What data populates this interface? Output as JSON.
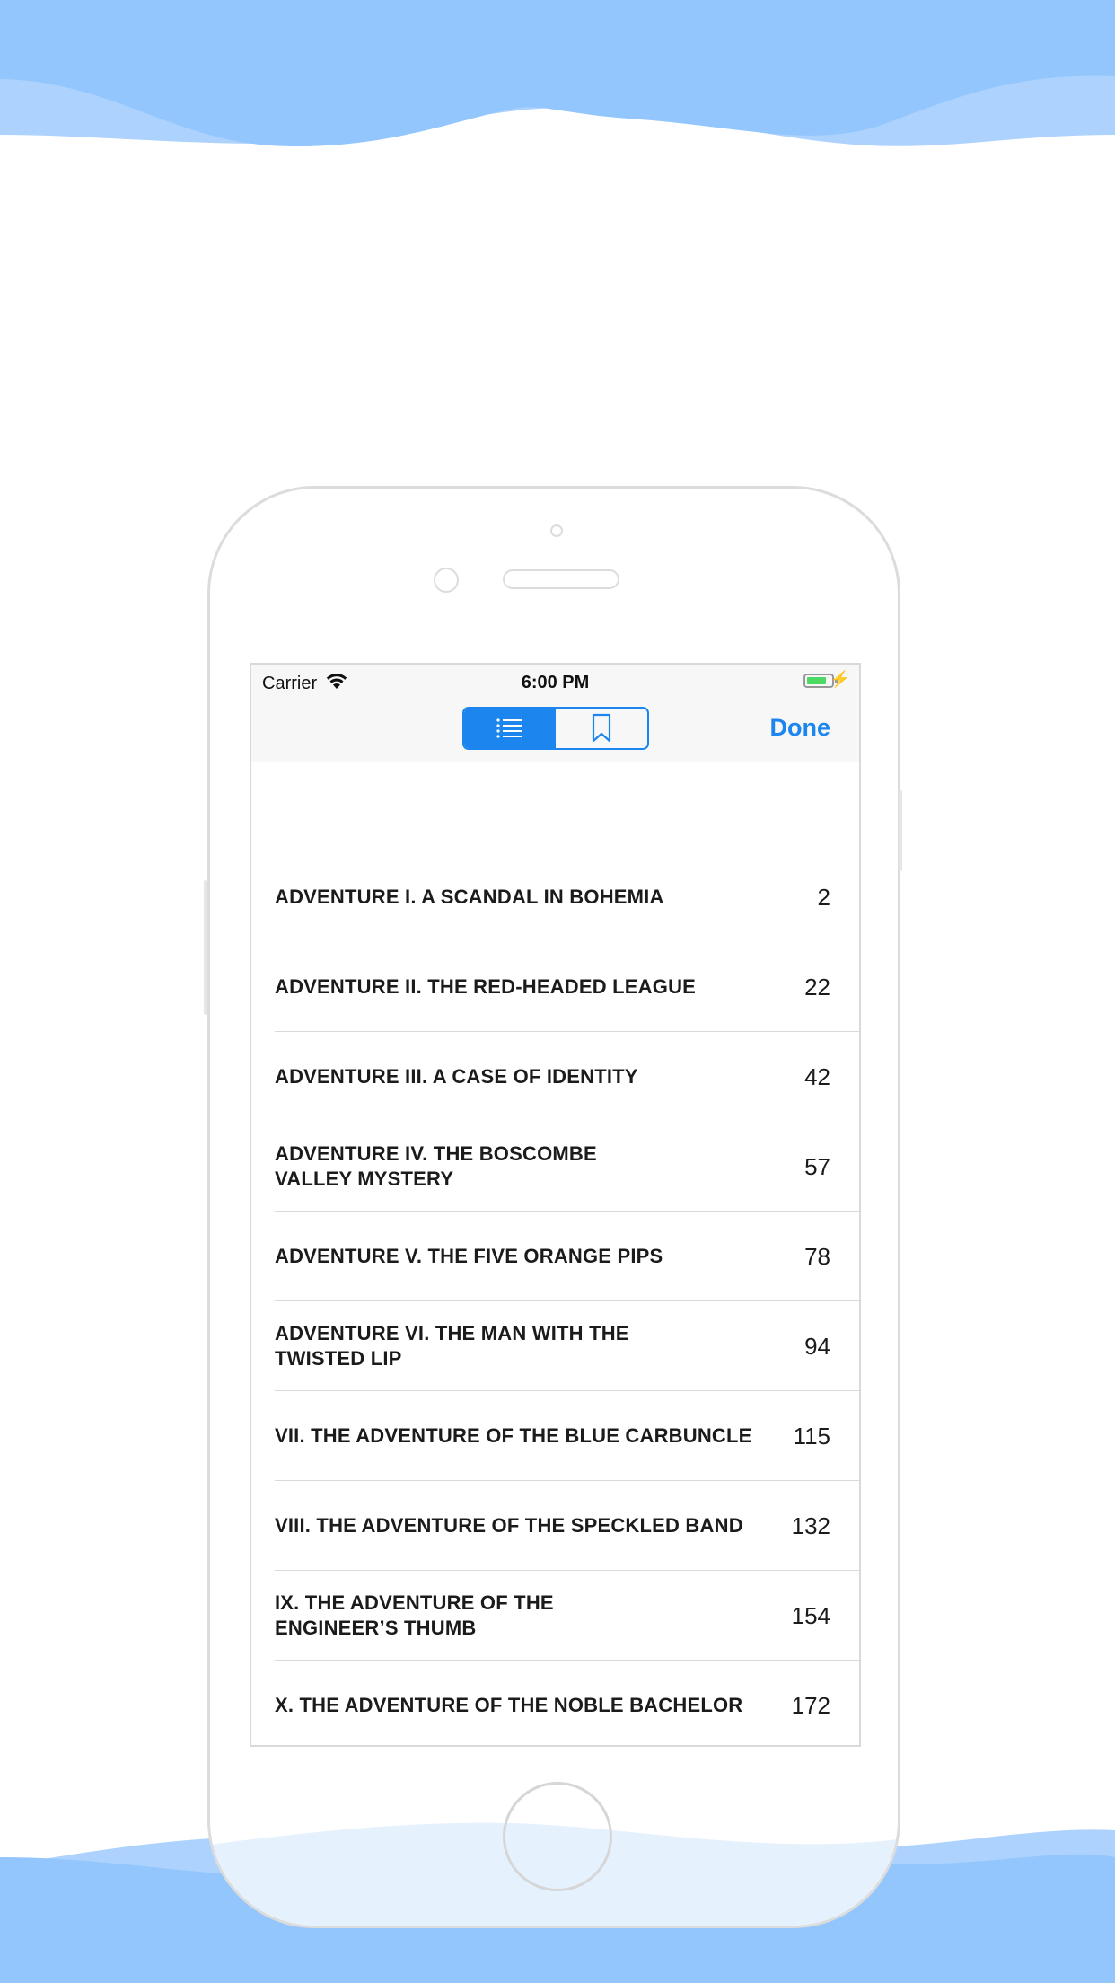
{
  "status_bar": {
    "carrier": "Carrier",
    "time": "6:00 PM",
    "battery_level": 0.8
  },
  "nav": {
    "segments": [
      {
        "name": "contents",
        "icon": "list-icon",
        "selected": true
      },
      {
        "name": "bookmarks",
        "icon": "bookmark-icon",
        "selected": false
      }
    ],
    "done_label": "Done"
  },
  "colors": {
    "accent": "#1c86ee",
    "wave": "#93c6fd",
    "battery": "#4cd964"
  },
  "toc": [
    {
      "title": "ADVENTURE I. A SCANDAL IN BOHEMIA",
      "page": "2",
      "separator": false
    },
    {
      "title": "ADVENTURE II. THE RED-HEADED LEAGUE",
      "page": "22",
      "separator": true
    },
    {
      "title": "ADVENTURE III. A CASE OF IDENTITY",
      "page": "42",
      "separator": false
    },
    {
      "title": "ADVENTURE IV. THE BOSCOMBE\nVALLEY MYSTERY",
      "page": "57",
      "separator": true
    },
    {
      "title": "ADVENTURE V. THE FIVE ORANGE PIPS",
      "page": "78",
      "separator": true
    },
    {
      "title": "ADVENTURE VI. THE MAN WITH THE\nTWISTED LIP",
      "page": "94",
      "separator": true
    },
    {
      "title": "VII. THE ADVENTURE OF THE BLUE CARBUNCLE",
      "page": "115",
      "separator": true
    },
    {
      "title": "VIII. THE ADVENTURE OF THE SPECKLED BAND",
      "page": "132",
      "separator": true
    },
    {
      "title": "IX. THE ADVENTURE OF THE\nENGINEER’S THUMB",
      "page": "154",
      "separator": true
    },
    {
      "title": "X. THE ADVENTURE OF THE NOBLE BACHELOR",
      "page": "172",
      "separator": false
    }
  ]
}
